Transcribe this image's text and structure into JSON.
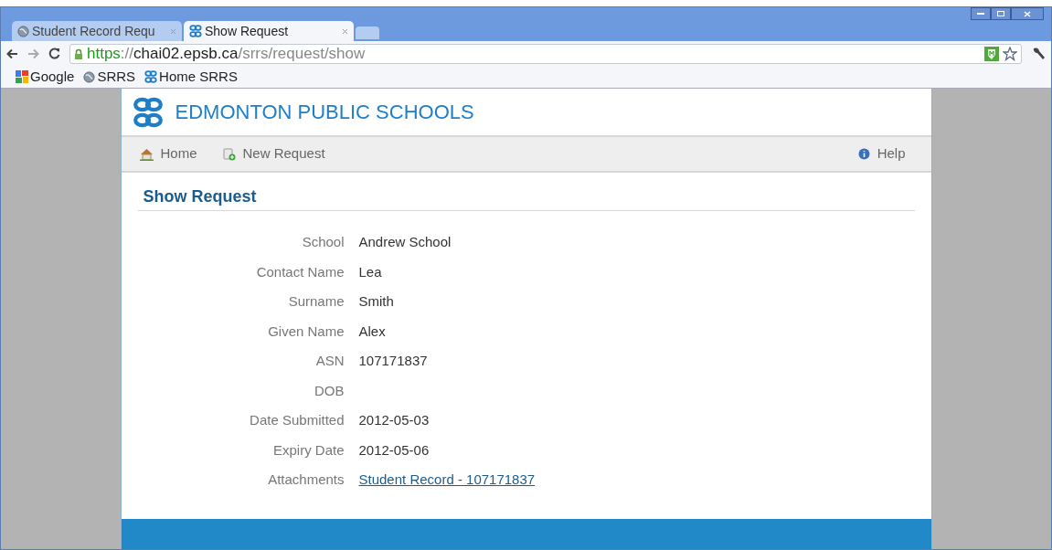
{
  "tabs": [
    {
      "label": "Student Record Requ",
      "kind": "globe",
      "selected": false
    },
    {
      "label": "Show Request",
      "kind": "logo",
      "selected": true
    }
  ],
  "address_bar": {
    "scheme": "https",
    "separator": "://",
    "host": "chai02.epsb.ca",
    "path": "/srrs/request/show"
  },
  "bookmarks": [
    {
      "label": "Google",
      "kind": "google"
    },
    {
      "label": "SRRS",
      "kind": "globe"
    },
    {
      "label": "Home SRRS",
      "kind": "logo"
    }
  ],
  "site_title": "EDMONTON PUBLIC SCHOOLS",
  "nav": [
    {
      "label": "Home",
      "kind": "home"
    },
    {
      "label": "New Request",
      "kind": "new"
    }
  ],
  "help": "Help",
  "heading": "Show Request",
  "fields": [
    {
      "label": "School",
      "value": "Andrew School",
      "kind": "text"
    },
    {
      "label": "Contact Name",
      "value": "Lea",
      "kind": "text"
    },
    {
      "label": "Surname",
      "value": "Smith",
      "kind": "text"
    },
    {
      "label": "Given Name",
      "value": "Alex",
      "kind": "text"
    },
    {
      "label": "ASN",
      "value": "107171837",
      "kind": "text"
    },
    {
      "label": "DOB",
      "kind": "text"
    },
    {
      "label": "Date Submitted",
      "value": "2012-05-03",
      "kind": "text"
    },
    {
      "label": "Expiry Date",
      "value": "2012-05-06",
      "kind": "text"
    },
    {
      "label": "Attachments",
      "value": "Student Record - 107171837",
      "kind": "link"
    }
  ]
}
